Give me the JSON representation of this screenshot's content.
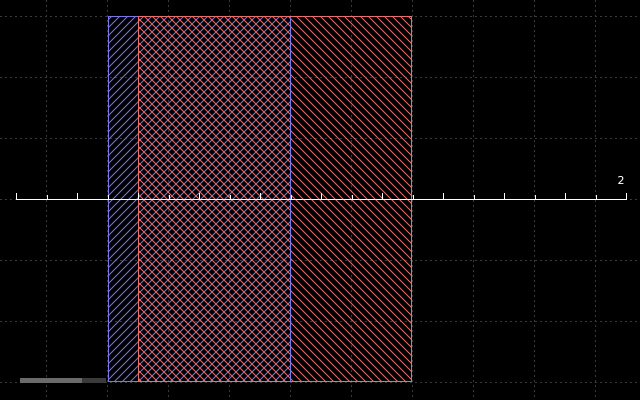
{
  "canvas": {
    "background_color": "#000000",
    "grid_color": "#3a3a3a",
    "grid": true
  },
  "axis": {
    "color": "#ffffff",
    "end_label": "2"
  },
  "rects": [
    {
      "name": "blue-hatched-rect",
      "stroke": "#7b76ea",
      "hatch": "forward-diagonal"
    },
    {
      "name": "red-hatched-rect",
      "stroke": "#e8706f",
      "hatch": "back-diagonal"
    }
  ],
  "status_bar": {
    "fill_fraction": 0.72,
    "track_color": "#3a3a3a",
    "fill_color": "#6a6a6a"
  }
}
